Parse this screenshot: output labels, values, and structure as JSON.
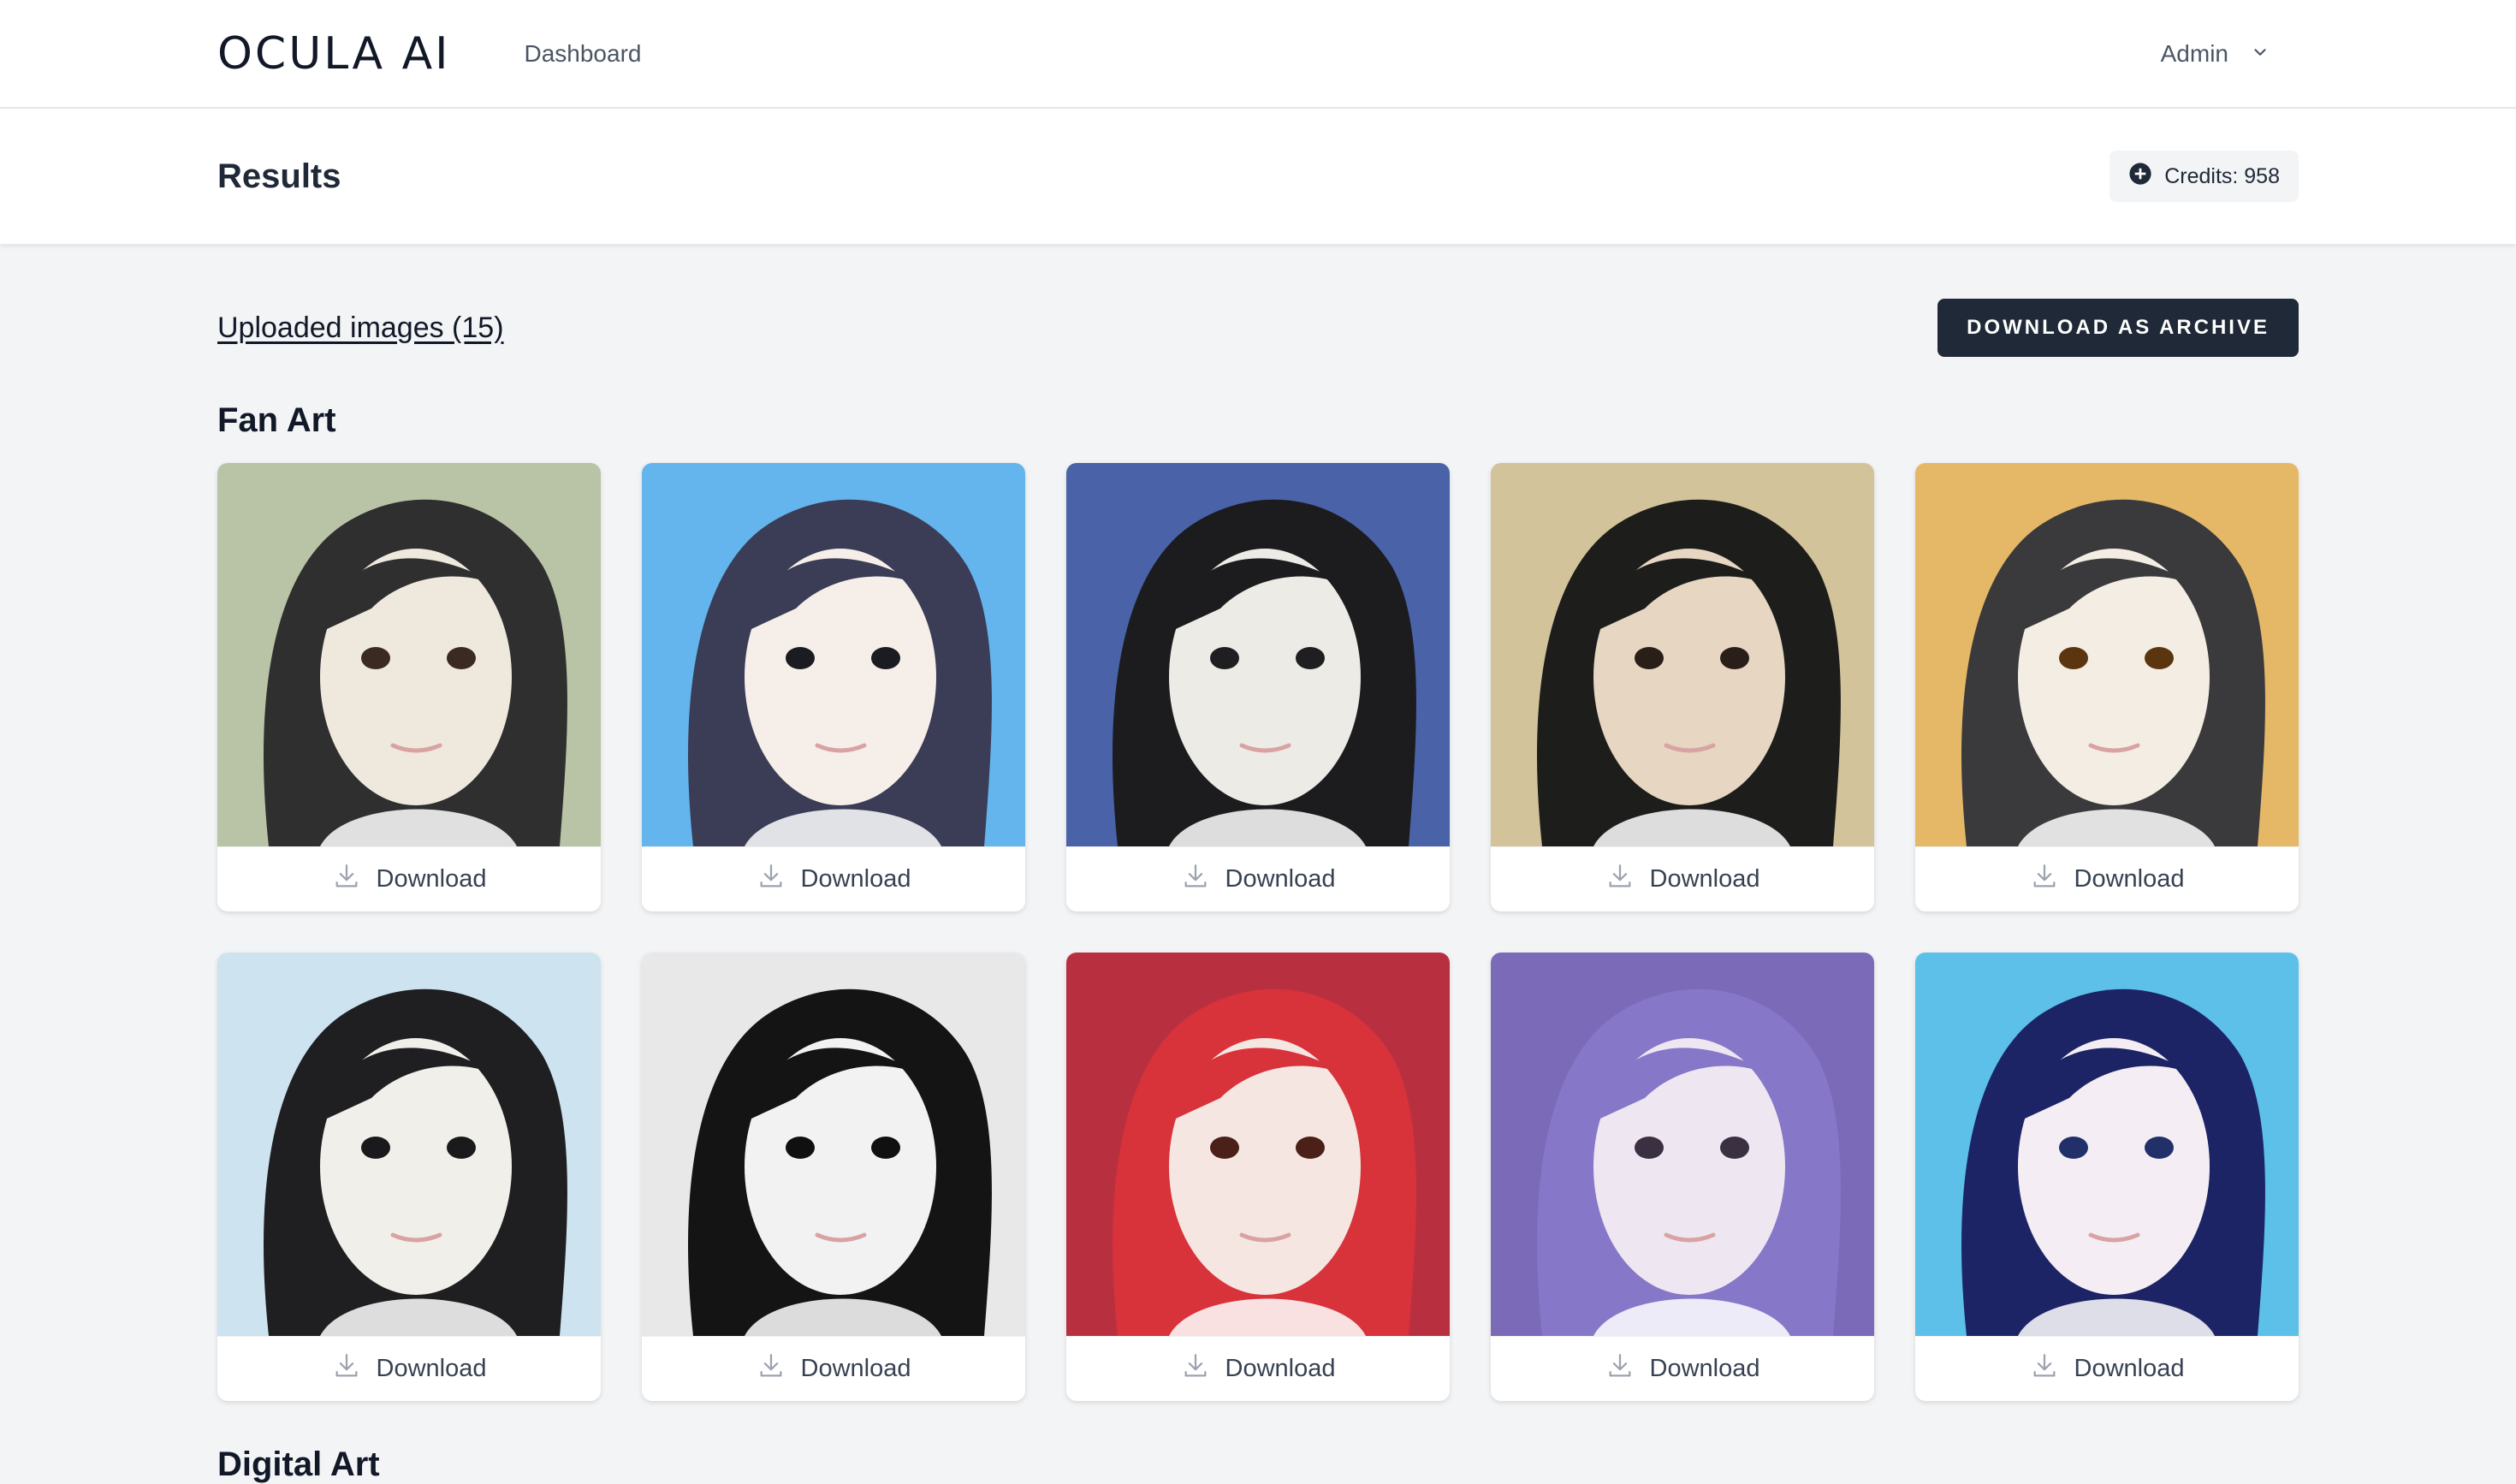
{
  "nav": {
    "logo": "OCULA AI",
    "dashboard_link": "Dashboard",
    "user_label": "Admin",
    "user_icon": "chevron-down-icon"
  },
  "header": {
    "title": "Results",
    "credits": "Credits: 958",
    "credits_icon": "plus-circle-icon"
  },
  "toolbar": {
    "uploaded_link": "Uploaded images (15)",
    "archive_button": "DOWNLOAD AS ARCHIVE"
  },
  "sections": [
    {
      "title": "Fan Art",
      "images": [
        {
          "download_label": "Download",
          "bg": "#b9c4a6",
          "hair": "#2f2f30",
          "skin": "#efe9dd",
          "eye": "#3a2a22"
        },
        {
          "download_label": "Download",
          "bg": "#64b4ee",
          "hair": "#3b3c56",
          "skin": "#f6eee8",
          "eye": "#1b1b22"
        },
        {
          "download_label": "Download",
          "bg": "#4a62a8",
          "hair": "#1c1c1e",
          "skin": "#ecebe6",
          "eye": "#1f1f22"
        },
        {
          "download_label": "Download",
          "bg": "#d2c39a",
          "hair": "#1d1d1c",
          "skin": "#e6d6c2",
          "eye": "#2a1e18"
        },
        {
          "download_label": "Download",
          "bg": "#e4b866",
          "hair": "#3a3a3c",
          "skin": "#f4ede4",
          "eye": "#5a3510"
        }
      ]
    },
    {
      "title": "Digital Art",
      "images": [
        {
          "download_label": "Download",
          "bg": "#cde4f0",
          "hair": "#1f1f22",
          "skin": "#f1efea",
          "eye": "#1a1a1c"
        },
        {
          "download_label": "Download",
          "bg": "#e8e8e8",
          "hair": "#141414",
          "skin": "#f2f2f2",
          "eye": "#101010"
        },
        {
          "download_label": "Download",
          "bg": "#b83040",
          "hair": "#d8323a",
          "skin": "#f6e6e2",
          "eye": "#4a2018"
        },
        {
          "download_label": "Download",
          "bg": "#7a6ab8",
          "hair": "#8677c8",
          "skin": "#eee6f0",
          "eye": "#3a3042"
        },
        {
          "download_label": "Download",
          "bg": "#5cc0e8",
          "hair": "#1c2466",
          "skin": "#f4eef4",
          "eye": "#22306a"
        }
      ]
    }
  ]
}
